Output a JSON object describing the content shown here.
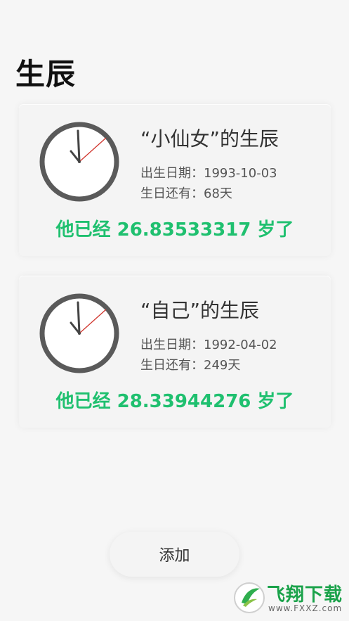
{
  "header": {
    "title": "生辰"
  },
  "cards": [
    {
      "title": "“小仙女”的生辰",
      "birth_date": "出生日期：1993-10-03",
      "days_left": "生日还有：68天",
      "age": "他已经 26.83533317 岁了"
    },
    {
      "title": "“自己”的生辰",
      "birth_date": "出生日期：1992-04-02",
      "days_left": "生日还有：249天",
      "age": "他已经 28.33944276 岁了"
    }
  ],
  "add_button": {
    "label": "添加"
  },
  "watermark": {
    "text": "飞翔下载",
    "url": "www.FXXZ.com"
  },
  "colors": {
    "accent_green": "#1fc06f",
    "second_hand": "#d0342c",
    "clock_hand": "#444444"
  },
  "icons": [
    "clock-icon"
  ]
}
